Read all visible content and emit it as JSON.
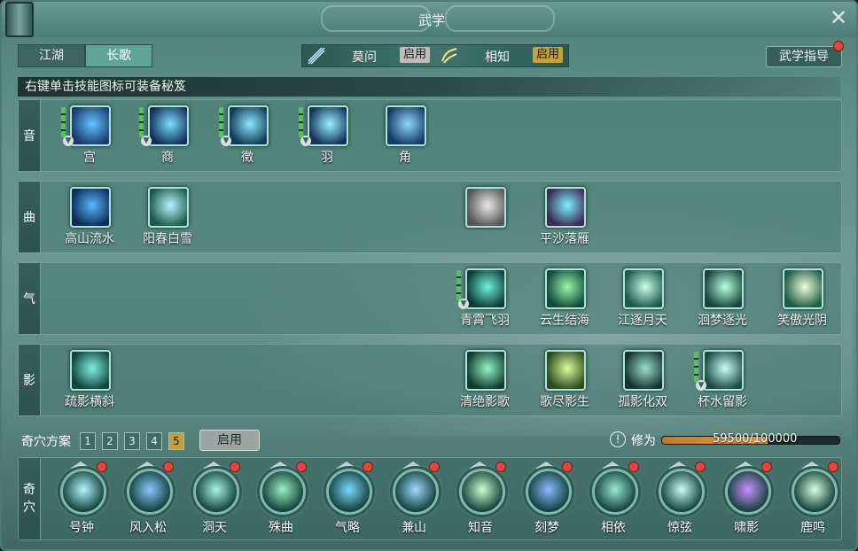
{
  "window": {
    "title": "武学"
  },
  "tabs": [
    {
      "label": "江湖",
      "active": false
    },
    {
      "label": "长歌",
      "active": true
    }
  ],
  "sets": {
    "set1": {
      "label": "莫问",
      "button": "启用",
      "button_style": "grey"
    },
    "set2": {
      "label": "相知",
      "button": "启用",
      "button_style": "gold"
    }
  },
  "guide_button": "武学指导",
  "hint": "右键单击技能图标可装备秘笈",
  "rows": [
    {
      "label": "音",
      "skills": [
        {
          "name": "宫",
          "col": 0,
          "has_bars": true,
          "has_drop": true,
          "icon": "hand-strings-icon"
        },
        {
          "name": "商",
          "col": 1,
          "has_bars": true,
          "has_drop": true,
          "icon": "hand-swirl-icon"
        },
        {
          "name": "徵",
          "col": 2,
          "has_bars": true,
          "has_drop": true,
          "icon": "hand-wind-icon"
        },
        {
          "name": "羽",
          "col": 3,
          "has_bars": true,
          "has_drop": true,
          "icon": "hand-wave-icon"
        },
        {
          "name": "角",
          "col": 4,
          "has_bars": false,
          "has_drop": false,
          "icon": "hand-flow-icon"
        }
      ]
    },
    {
      "label": "曲",
      "skills": [
        {
          "name": "高山流水",
          "col": 0,
          "has_bars": false,
          "has_drop": false,
          "icon": "water-drop-icon"
        },
        {
          "name": "阳春白雪",
          "col": 1,
          "has_bars": false,
          "has_drop": false,
          "icon": "snowflake-icon"
        },
        {
          "name": "",
          "col": 5,
          "has_bars": false,
          "has_drop": false,
          "icon": "white-flower-icon"
        },
        {
          "name": "平沙落雁",
          "col": 6,
          "has_bars": false,
          "has_drop": false,
          "icon": "figure-aura-icon"
        }
      ]
    },
    {
      "label": "气",
      "skills": [
        {
          "name": "青霄飞羽",
          "col": 5,
          "has_bars": true,
          "has_drop": true,
          "icon": "slash-icon"
        },
        {
          "name": "云生结海",
          "col": 6,
          "has_bars": false,
          "has_drop": false,
          "icon": "whirlpool-icon"
        },
        {
          "name": "江逐月天",
          "col": 7,
          "has_bars": false,
          "has_drop": false,
          "icon": "sparkle-burst-icon"
        },
        {
          "name": "洄梦逐光",
          "col": 8,
          "has_bars": false,
          "has_drop": false,
          "icon": "dream-figure-icon"
        },
        {
          "name": "笑傲光阴",
          "col": 9,
          "has_bars": false,
          "has_drop": false,
          "icon": "light-flare-icon"
        }
      ]
    },
    {
      "label": "影",
      "skills": [
        {
          "name": "疏影横斜",
          "col": 0,
          "has_bars": false,
          "has_drop": false,
          "icon": "shadow-dash-icon"
        },
        {
          "name": "清绝影歌",
          "col": 5,
          "has_bars": false,
          "has_drop": false,
          "icon": "sprint-icon"
        },
        {
          "name": "歌尽影生",
          "col": 6,
          "has_bars": false,
          "has_drop": false,
          "icon": "blade-streak-icon"
        },
        {
          "name": "孤影化双",
          "col": 7,
          "has_bars": false,
          "has_drop": false,
          "icon": "shadow-clone-icon"
        },
        {
          "name": "杯水留影",
          "col": 8,
          "has_bars": true,
          "has_drop": true,
          "icon": "heart-ring-icon"
        }
      ]
    }
  ],
  "qixue": {
    "plan_label": "奇穴方案",
    "plans": [
      "1",
      "2",
      "3",
      "4",
      "5"
    ],
    "selected_plan": "5",
    "enable_button": "启用",
    "xiuwei_label": "修为",
    "xiuwei_text": "59500/100000",
    "xiuwei_fraction": 0.595,
    "side_label_1": "奇",
    "side_label_2": "穴",
    "points": [
      {
        "name": "号钟",
        "icon": "heart-chime-icon"
      },
      {
        "name": "风入松",
        "icon": "wind-figure-icon"
      },
      {
        "name": "洞天",
        "icon": "vortex-icon"
      },
      {
        "name": "殊曲",
        "icon": "leaf-swirl-icon"
      },
      {
        "name": "气略",
        "icon": "comet-icon"
      },
      {
        "name": "兼山",
        "icon": "mountain-wave-icon"
      },
      {
        "name": "知音",
        "icon": "sound-ring-icon"
      },
      {
        "name": "刻梦",
        "icon": "star-burst-icon"
      },
      {
        "name": "相依",
        "icon": "embrace-icon"
      },
      {
        "name": "惊弦",
        "icon": "string-burst-icon"
      },
      {
        "name": "啸影",
        "icon": "purple-eye-icon"
      },
      {
        "name": "鹿鸣",
        "icon": "deer-icon"
      }
    ]
  },
  "colors": {
    "accent_gold": "#c5a23c",
    "xiuwei_fill": "#d18f3c",
    "red_dot": "#e5453f"
  }
}
